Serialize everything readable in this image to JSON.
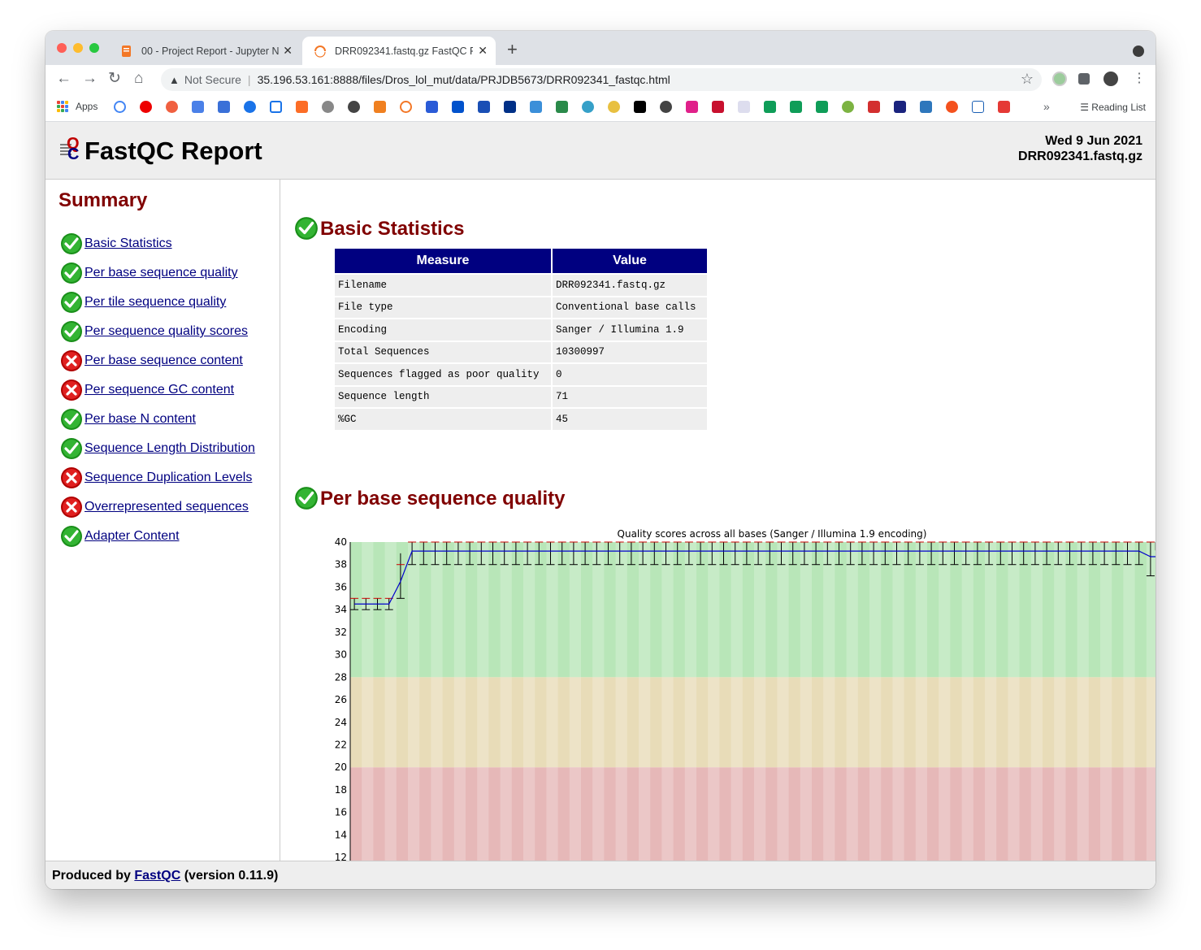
{
  "browser": {
    "tabs": [
      {
        "title": "00 - Project Report - Jupyter N",
        "active": false
      },
      {
        "title": "DRR092341.fastq.gz FastQC R",
        "active": true
      }
    ],
    "new_tab": "+",
    "close": "✕",
    "security_label": "Not Secure",
    "url": "35.196.53.161:8888/files/Dros_lol_mut/data/PRJDB5673/DRR092341_fastqc.html",
    "apps_label": "Apps",
    "reading_list": "Reading List",
    "overflow": "»"
  },
  "report": {
    "title": "FastQC Report",
    "date": "Wed 9 Jun 2021",
    "filename": "DRR092341.fastq.gz"
  },
  "summary": {
    "heading": "Summary",
    "items": [
      {
        "label": "Basic Statistics",
        "status": "pass"
      },
      {
        "label": "Per base sequence quality",
        "status": "pass"
      },
      {
        "label": "Per tile sequence quality",
        "status": "pass"
      },
      {
        "label": "Per sequence quality scores",
        "status": "pass"
      },
      {
        "label": "Per base sequence content",
        "status": "fail"
      },
      {
        "label": "Per sequence GC content",
        "status": "fail"
      },
      {
        "label": "Per base N content",
        "status": "pass"
      },
      {
        "label": "Sequence Length Distribution",
        "status": "pass"
      },
      {
        "label": "Sequence Duplication Levels",
        "status": "fail"
      },
      {
        "label": "Overrepresented sequences",
        "status": "fail"
      },
      {
        "label": "Adapter Content",
        "status": "pass"
      }
    ]
  },
  "basic_stats": {
    "title": "Basic Statistics",
    "headers": [
      "Measure",
      "Value"
    ],
    "rows": [
      [
        "Filename",
        "DRR092341.fastq.gz"
      ],
      [
        "File type",
        "Conventional base calls"
      ],
      [
        "Encoding",
        "Sanger / Illumina 1.9"
      ],
      [
        "Total Sequences",
        "10300997"
      ],
      [
        "Sequences flagged as poor quality",
        "0"
      ],
      [
        "Sequence length",
        "71"
      ],
      [
        "%GC",
        "45"
      ]
    ]
  },
  "per_base_quality": {
    "title": "Per base sequence quality"
  },
  "chart_data": {
    "type": "line",
    "title": "Quality scores across all bases (Sanger / Illumina 1.9 encoding)",
    "y_ticks": [
      40,
      38,
      36,
      34,
      32,
      30,
      28,
      26,
      24,
      22,
      20,
      18,
      16,
      14,
      12
    ],
    "ylim": [
      11,
      40
    ],
    "zones": [
      {
        "from": 28,
        "to": 40,
        "color": "#b8e6b8"
      },
      {
        "from": 20,
        "to": 28,
        "color": "#e8dcb8"
      },
      {
        "from": 0,
        "to": 20,
        "color": "#e6b8b8"
      }
    ],
    "n_positions": 71,
    "mean_start": 34.5,
    "mean_mid": 39.2,
    "mean_end": 38.7,
    "median_start": 35,
    "median_mid": 40,
    "colors": {
      "mean": "#0000cc",
      "median": "#cc0000",
      "box": "#f0e000"
    }
  },
  "footer": {
    "prefix": "Produced by",
    "link": "FastQC",
    "suffix": "(version 0.11.9)"
  }
}
